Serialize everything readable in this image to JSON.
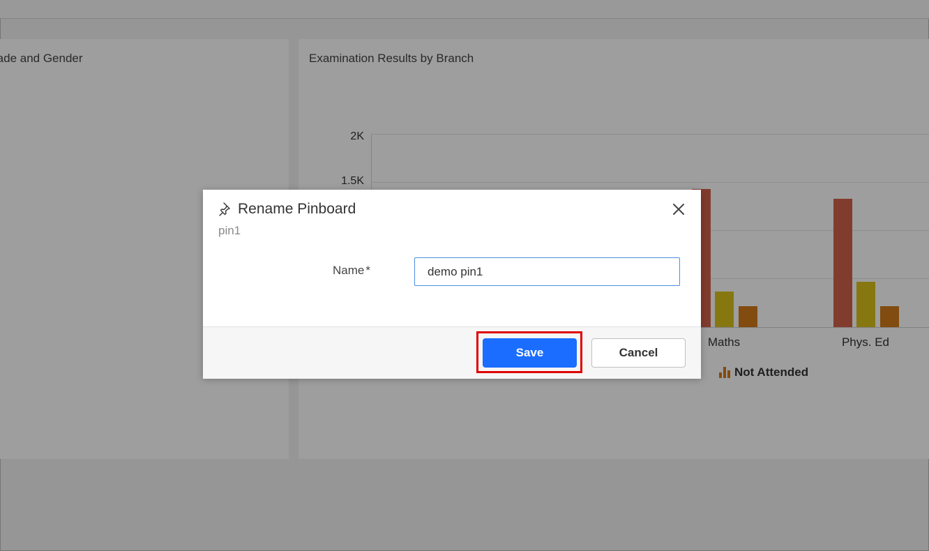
{
  "background": {
    "left_card": {
      "title": "rade and Gender"
    },
    "right_card": {
      "title": "Examination Results by Branch",
      "y_ticks": [
        "2K",
        "1.5K"
      ],
      "categories": [
        "Maths",
        "Phys. Ed"
      ],
      "legend_item": "Not Attended"
    }
  },
  "chart_data": {
    "type": "bar",
    "title": "Examination Results by Branch",
    "categories": [
      "Maths",
      "Phys. Ed"
    ],
    "series": [
      {
        "color": "#d2624a",
        "values": [
          1430,
          1330
        ]
      },
      {
        "color": "#d9c11c",
        "values": [
          370,
          470
        ]
      },
      {
        "name": "Not Attended",
        "color": "#d27a19",
        "values": [
          220,
          220
        ]
      }
    ],
    "ylim": [
      0,
      2000
    ],
    "y_ticks": [
      "2K",
      "1.5K"
    ]
  },
  "dialog": {
    "title": "Rename Pinboard",
    "subtitle": "pin1",
    "name_label": "Name",
    "required_mark": "*",
    "name_value": "demo pin1",
    "save_label": "Save",
    "cancel_label": "Cancel"
  },
  "colors": {
    "primary": "#1a6dff",
    "highlight": "#e00000",
    "input_border": "#4a8fe0"
  },
  "icons": {
    "pin": "pin-icon",
    "close": "close-icon",
    "legend": "bar-chart-icon"
  }
}
